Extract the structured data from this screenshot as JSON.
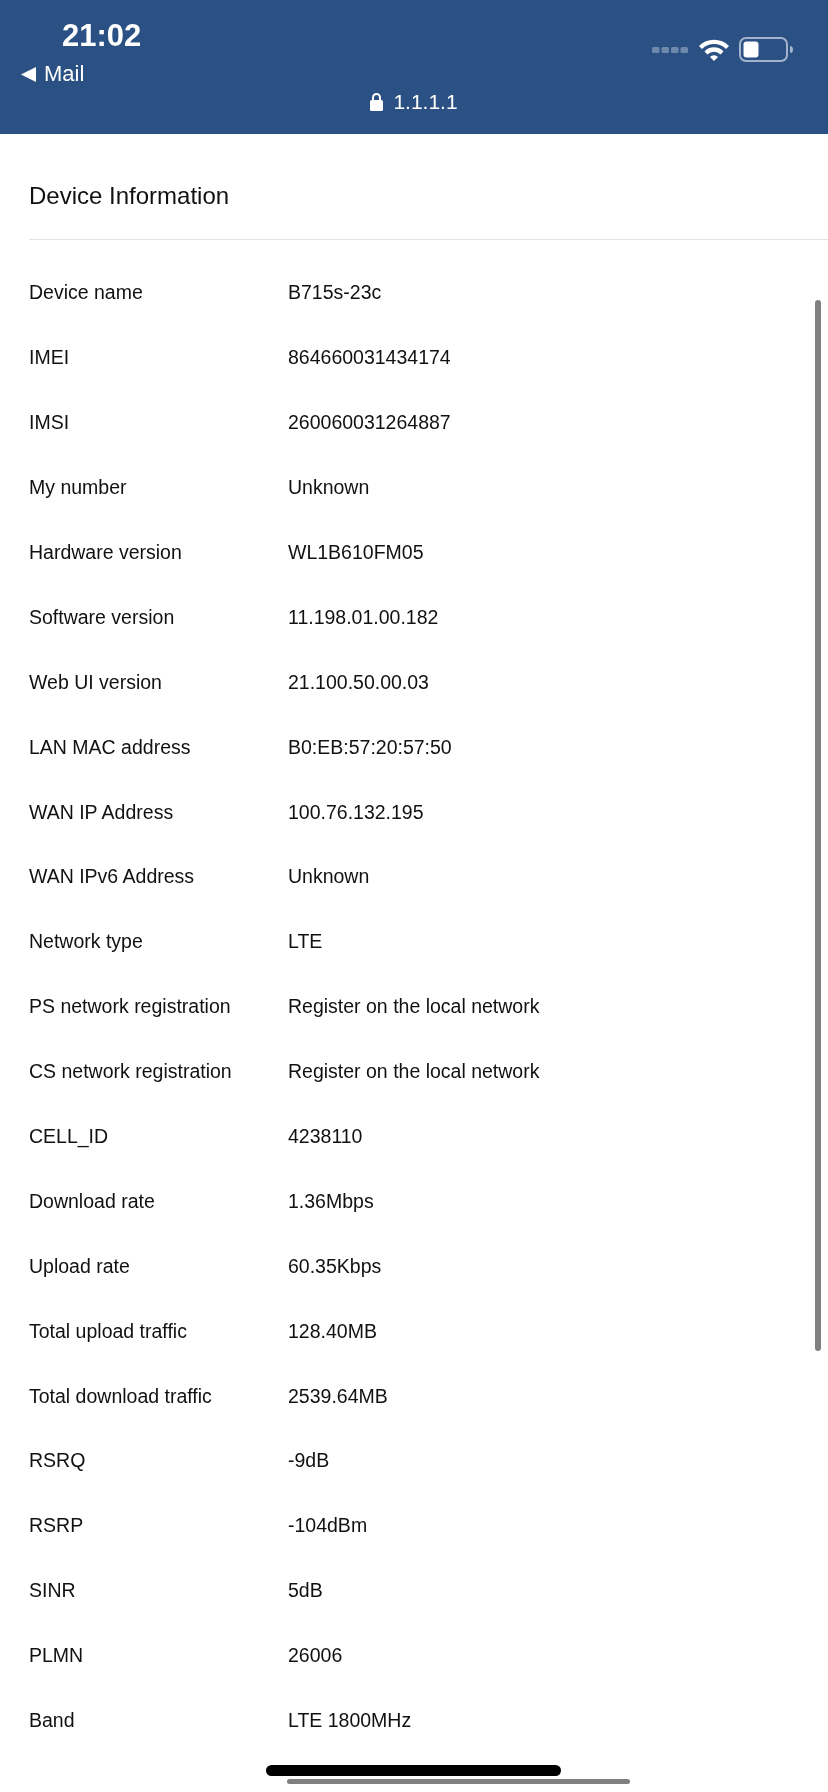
{
  "status_bar": {
    "time": "21:02",
    "back_label": "Mail"
  },
  "address_bar": {
    "url": "1.1.1.1",
    "secure": true
  },
  "section": {
    "title": "Device Information"
  },
  "rows": [
    {
      "label": "Device name",
      "value": "B715s-23c"
    },
    {
      "label": "IMEI",
      "value": "864660031434174"
    },
    {
      "label": "IMSI",
      "value": "260060031264887"
    },
    {
      "label": "My number",
      "value": "Unknown"
    },
    {
      "label": "Hardware version",
      "value": "WL1B610FM05"
    },
    {
      "label": "Software version",
      "value": "11.198.01.00.182"
    },
    {
      "label": "Web UI version",
      "value": "21.100.50.00.03"
    },
    {
      "label": "LAN MAC address",
      "value": "B0:EB:57:20:57:50"
    },
    {
      "label": "WAN IP Address",
      "value": "100.76.132.195"
    },
    {
      "label": "WAN IPv6 Address",
      "value": "Unknown"
    },
    {
      "label": "Network type",
      "value": "LTE"
    },
    {
      "label": "PS network registration",
      "value": "Register on the local network"
    },
    {
      "label": "CS network registration",
      "value": "Register on the local network"
    },
    {
      "label": "CELL_ID",
      "value": "4238110"
    },
    {
      "label": "Download rate",
      "value": "1.36Mbps"
    },
    {
      "label": "Upload rate",
      "value": "60.35Kbps"
    },
    {
      "label": "Total upload traffic",
      "value": "128.40MB"
    },
    {
      "label": "Total download traffic",
      "value": "2539.64MB"
    },
    {
      "label": "RSRQ",
      "value": "-9dB"
    },
    {
      "label": "RSRP",
      "value": "-104dBm"
    },
    {
      "label": "SINR",
      "value": "5dB"
    },
    {
      "label": "PLMN",
      "value": "26006"
    },
    {
      "label": "Band",
      "value": "LTE 1800MHz"
    }
  ]
}
